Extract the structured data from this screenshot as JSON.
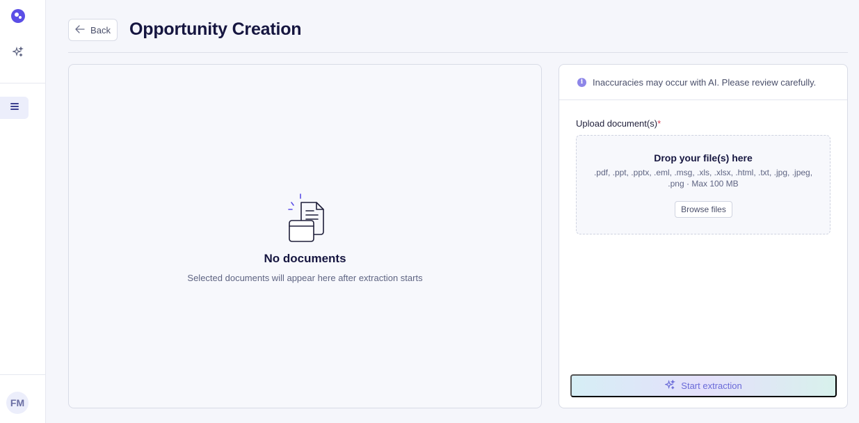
{
  "sidebar": {
    "logo_icon": "app-logo-icon",
    "items": [
      {
        "icon": "sparkles-icon"
      },
      {
        "icon": "list-icon",
        "active": true
      }
    ],
    "avatar_initials": "FM"
  },
  "header": {
    "back_label": "Back",
    "title": "Opportunity Creation"
  },
  "documents": {
    "empty_title": "No documents",
    "empty_subtitle": "Selected documents will appear here after extraction starts"
  },
  "upload": {
    "notice": "Inaccuracies may occur with AI. Please review carefully.",
    "label": "Upload document(s)",
    "required_mark": "*",
    "drop_title": "Drop your file(s) here",
    "accepted_types": ".pdf, .ppt, .pptx, .eml, .msg, .xls, .xlsx, .html, .txt, .jpg, .jpeg, .png · Max 100 MB",
    "browse_label": "Browse files",
    "start_label": "Start extraction"
  },
  "colors": {
    "accent": "#5b4ee6",
    "title": "#161640",
    "required": "#d63b4f"
  }
}
